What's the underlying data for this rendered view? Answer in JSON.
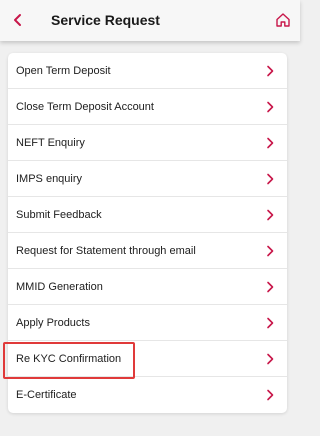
{
  "header": {
    "title": "Service Request",
    "back_icon": "chevron-left-icon",
    "home_icon": "home-icon"
  },
  "colors": {
    "accent": "#c8174a",
    "highlight": "#e03a3a"
  },
  "menu": {
    "items": [
      {
        "label": "Open Term Deposit"
      },
      {
        "label": "Close Term Deposit Account"
      },
      {
        "label": "NEFT Enquiry"
      },
      {
        "label": "IMPS enquiry"
      },
      {
        "label": "Submit Feedback"
      },
      {
        "label": "Request for Statement through email"
      },
      {
        "label": "MMID Generation"
      },
      {
        "label": "Apply Products"
      },
      {
        "label": "Re KYC Confirmation"
      },
      {
        "label": "E-Certificate"
      }
    ],
    "highlighted_item": "Re KYC Confirmation"
  }
}
